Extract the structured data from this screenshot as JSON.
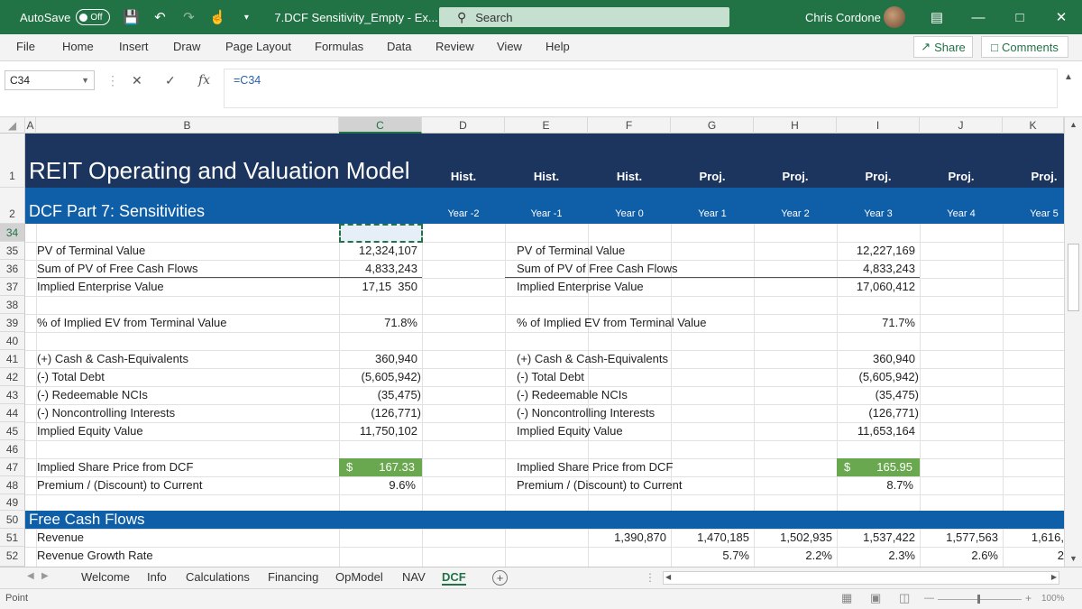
{
  "titlebar": {
    "autosave_label": "AutoSave",
    "autosave_state": "Off",
    "doc_title": "7.DCF Sensitivity_Empty  -  Ex...",
    "search_placeholder": "Search",
    "user_name": "Chris Cordone"
  },
  "ribbon": {
    "tabs": [
      "File",
      "Home",
      "Insert",
      "Draw",
      "Page Layout",
      "Formulas",
      "Data",
      "Review",
      "View",
      "Help"
    ],
    "share_label": "Share",
    "comments_label": "Comments"
  },
  "formula_bar": {
    "name_box": "C34",
    "formula": "=C34"
  },
  "columns": [
    "A",
    "B",
    "C",
    "D",
    "E",
    "F",
    "G",
    "H",
    "I",
    "J",
    "K"
  ],
  "banner": {
    "main_title": "REIT Operating and Valuation Model",
    "sub_title": "DCF Part 7: Sensitivities",
    "period_types": [
      "Hist.",
      "Hist.",
      "Hist.",
      "Proj.",
      "Proj.",
      "Proj.",
      "Proj.",
      "Proj."
    ],
    "years": [
      "Year -2",
      "Year -1",
      "Year 0",
      "Year 1",
      "Year 2",
      "Year 3",
      "Year 4",
      "Year 5"
    ]
  },
  "rows": {
    "r34": "34",
    "r35": "35",
    "r36": "36",
    "r37": "37",
    "r38": "38",
    "r39": "39",
    "r40": "40",
    "r41": "41",
    "r42": "42",
    "r43": "43",
    "r44": "44",
    "r45": "45",
    "r46": "46",
    "r47": "47",
    "r48": "48",
    "r49": "49",
    "r50": "50",
    "r51": "51",
    "r52": "52",
    "r1": "1",
    "r2": "2"
  },
  "left_block": {
    "pv_terminal_label": "PV of Terminal Value",
    "pv_terminal": "12,324,107",
    "sum_pv_label": "Sum of PV of Free Cash Flows",
    "sum_pv": "4,833,243",
    "implied_ev_label": "Implied Enterprise Value",
    "implied_ev": "17,15  350",
    "pct_tv_label": "% of Implied EV from Terminal Value",
    "pct_tv": "71.8%",
    "cash_label": "(+) Cash & Cash-Equivalents",
    "cash": "360,940",
    "debt_label": "(-) Total Debt",
    "debt": "(5,605,942)",
    "redeem_label": "(-) Redeemable NCIs",
    "redeem": "(35,475)",
    "nci_label": "(-) Noncontrolling Interests",
    "nci": "(126,771)",
    "equity_label": "Implied Equity Value",
    "equity": "11,750,102",
    "share_label": "Implied Share Price from DCF",
    "share_currency": "$",
    "share_price": "167.33",
    "premium_label": "Premium / (Discount) to Current",
    "premium": "9.6%"
  },
  "right_block": {
    "pv_terminal_label": "PV of Terminal Value",
    "pv_terminal": "12,227,169",
    "sum_pv_label": "Sum of PV of Free Cash Flows",
    "sum_pv": "4,833,243",
    "implied_ev_label": "Implied Enterprise Value",
    "implied_ev": "17,060,412",
    "pct_tv_label": "% of Implied EV from Terminal Value",
    "pct_tv": "71.7%",
    "cash_label": "(+) Cash & Cash-Equivalents",
    "cash": "360,940",
    "debt_label": "(-) Total Debt",
    "debt": "(5,605,942)",
    "redeem_label": "(-) Redeemable NCIs",
    "redeem": "(35,475)",
    "nci_label": "(-) Noncontrolling Interests",
    "nci": "(126,771)",
    "equity_label": "Implied Equity Value",
    "equity": "11,653,164",
    "share_label": "Implied Share Price from DCF",
    "share_currency": "$",
    "share_price": "165.95",
    "premium_label": "Premium / (Discount) to Current",
    "premium": "8.7%"
  },
  "fcf": {
    "title": "Free Cash Flows",
    "revenue_label": "Revenue",
    "revenue": [
      "1,390,870",
      "1,470,185",
      "1,502,935",
      "1,537,422",
      "1,577,563",
      "1,616,"
    ],
    "growth_label": "Revenue Growth Rate",
    "growth": [
      "5.7%",
      "2.2%",
      "2.3%",
      "2.6%",
      "2"
    ]
  },
  "sheet_tabs": [
    "Welcome",
    "Info",
    "Calculations",
    "Financing",
    "OpModel",
    "NAV",
    "DCF"
  ],
  "status": {
    "mode": "Point",
    "zoom": "100%"
  },
  "colors": {
    "excel_green": "#217346",
    "navy": "#1c355e",
    "blue": "#0f5ea8",
    "green_cell": "#6aa84f"
  }
}
